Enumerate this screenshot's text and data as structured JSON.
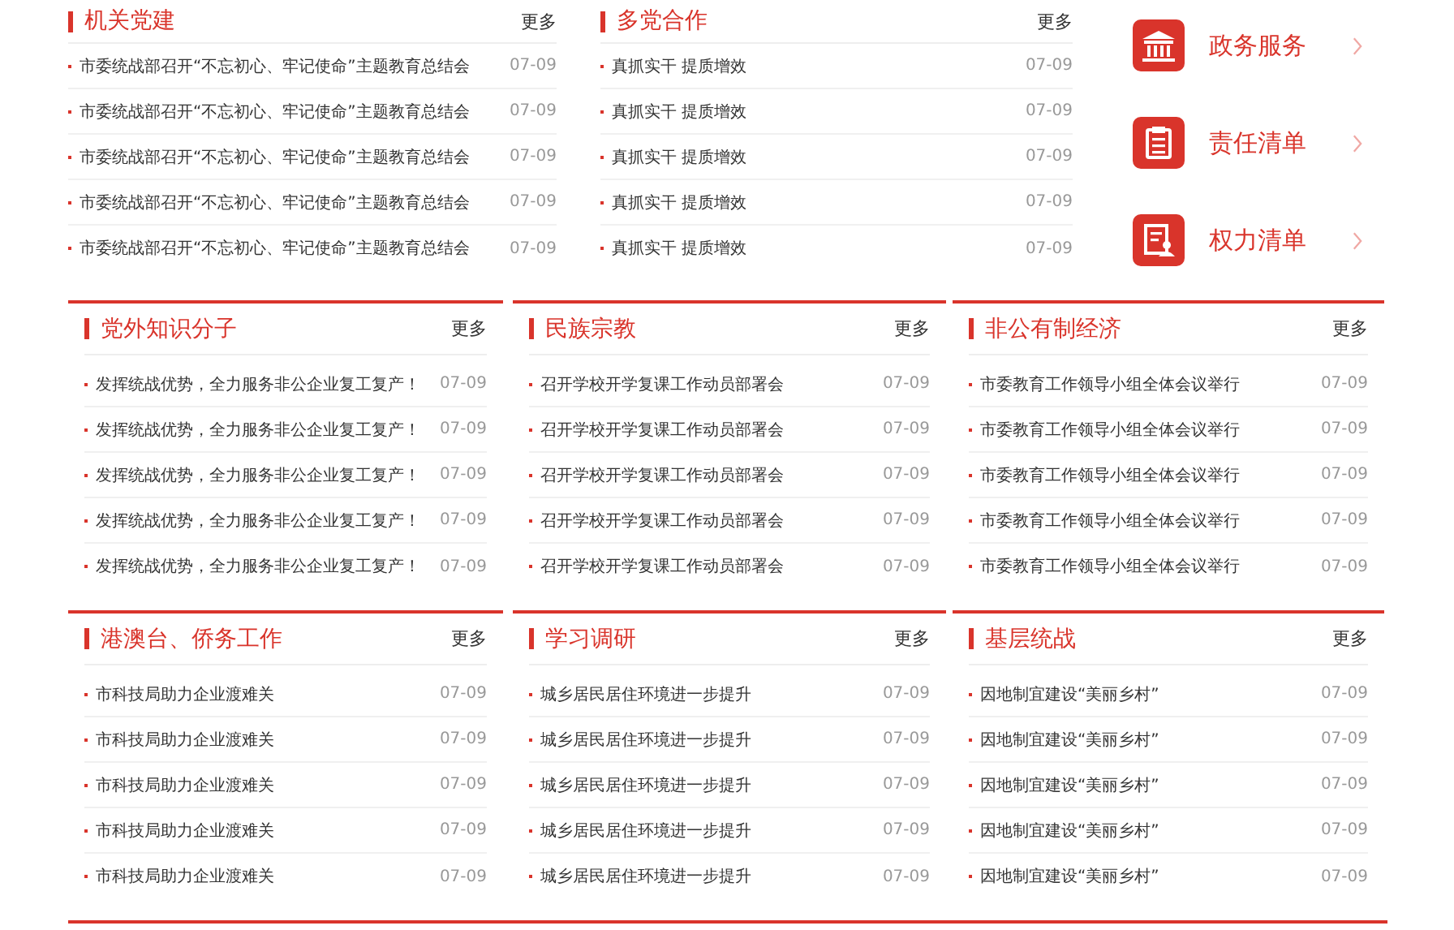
{
  "top_panels": [
    {
      "title": "机关党建",
      "more": "更多",
      "items": [
        {
          "text": "市委统战部召开“不忘初心、牢记使命”主题教育总结会",
          "date": "07-09"
        },
        {
          "text": "市委统战部召开“不忘初心、牢记使命”主题教育总结会",
          "date": "07-09"
        },
        {
          "text": "市委统战部召开“不忘初心、牢记使命”主题教育总结会",
          "date": "07-09"
        },
        {
          "text": "市委统战部召开“不忘初心、牢记使命”主题教育总结会",
          "date": "07-09"
        },
        {
          "text": "市委统战部召开“不忘初心、牢记使命”主题教育总结会",
          "date": "07-09"
        }
      ]
    },
    {
      "title": "多党合作",
      "more": "更多",
      "items": [
        {
          "text": "真抓实干 提质增效",
          "date": "07-09"
        },
        {
          "text": "真抓实干 提质增效",
          "date": "07-09"
        },
        {
          "text": "真抓实干 提质增效",
          "date": "07-09"
        },
        {
          "text": "真抓实干 提质增效",
          "date": "07-09"
        },
        {
          "text": "真抓实干 提质增效",
          "date": "07-09"
        }
      ]
    }
  ],
  "quick_links": [
    {
      "kind": "building",
      "label": "政务服务"
    },
    {
      "kind": "clipboard",
      "label": "责任清单"
    },
    {
      "kind": "document-person",
      "label": "权力清单"
    }
  ],
  "sections": [
    {
      "title": "党外知识分子",
      "more": "更多",
      "items": [
        {
          "text": "发挥统战优势，全力服务非公企业复工复产！",
          "date": "07-09"
        },
        {
          "text": "发挥统战优势，全力服务非公企业复工复产！",
          "date": "07-09"
        },
        {
          "text": "发挥统战优势，全力服务非公企业复工复产！",
          "date": "07-09"
        },
        {
          "text": "发挥统战优势，全力服务非公企业复工复产！",
          "date": "07-09"
        },
        {
          "text": "发挥统战优势，全力服务非公企业复工复产！",
          "date": "07-09"
        }
      ]
    },
    {
      "title": "民族宗教",
      "more": "更多",
      "items": [
        {
          "text": "召开学校开学复课工作动员部署会",
          "date": "07-09"
        },
        {
          "text": "召开学校开学复课工作动员部署会",
          "date": "07-09"
        },
        {
          "text": "召开学校开学复课工作动员部署会",
          "date": "07-09"
        },
        {
          "text": "召开学校开学复课工作动员部署会",
          "date": "07-09"
        },
        {
          "text": "召开学校开学复课工作动员部署会",
          "date": "07-09"
        }
      ]
    },
    {
      "title": "非公有制经济",
      "more": "更多",
      "items": [
        {
          "text": "市委教育工作领导小组全体会议举行",
          "date": "07-09"
        },
        {
          "text": "市委教育工作领导小组全体会议举行",
          "date": "07-09"
        },
        {
          "text": "市委教育工作领导小组全体会议举行",
          "date": "07-09"
        },
        {
          "text": "市委教育工作领导小组全体会议举行",
          "date": "07-09"
        },
        {
          "text": "市委教育工作领导小组全体会议举行",
          "date": "07-09"
        }
      ]
    },
    {
      "title": "港澳台、侨务工作",
      "more": "更多",
      "items": [
        {
          "text": "市科技局助力企业渡难关",
          "date": "07-09"
        },
        {
          "text": "市科技局助力企业渡难关",
          "date": "07-09"
        },
        {
          "text": "市科技局助力企业渡难关",
          "date": "07-09"
        },
        {
          "text": "市科技局助力企业渡难关",
          "date": "07-09"
        },
        {
          "text": "市科技局助力企业渡难关",
          "date": "07-09"
        }
      ]
    },
    {
      "title": "学习调研",
      "more": "更多",
      "items": [
        {
          "text": "城乡居民居住环境进一步提升",
          "date": "07-09"
        },
        {
          "text": "城乡居民居住环境进一步提升",
          "date": "07-09"
        },
        {
          "text": "城乡居民居住环境进一步提升",
          "date": "07-09"
        },
        {
          "text": "城乡居民居住环境进一步提升",
          "date": "07-09"
        },
        {
          "text": "城乡居民居住环境进一步提升",
          "date": "07-09"
        }
      ]
    },
    {
      "title": "基层统战",
      "more": "更多",
      "items": [
        {
          "text": "因地制宜建设“美丽乡村”",
          "date": "07-09"
        },
        {
          "text": "因地制宜建设“美丽乡村”",
          "date": "07-09"
        },
        {
          "text": "因地制宜建设“美丽乡村”",
          "date": "07-09"
        },
        {
          "text": "因地制宜建设“美丽乡村”",
          "date": "07-09"
        },
        {
          "text": "因地制宜建设“美丽乡村”",
          "date": "07-09"
        }
      ]
    }
  ]
}
